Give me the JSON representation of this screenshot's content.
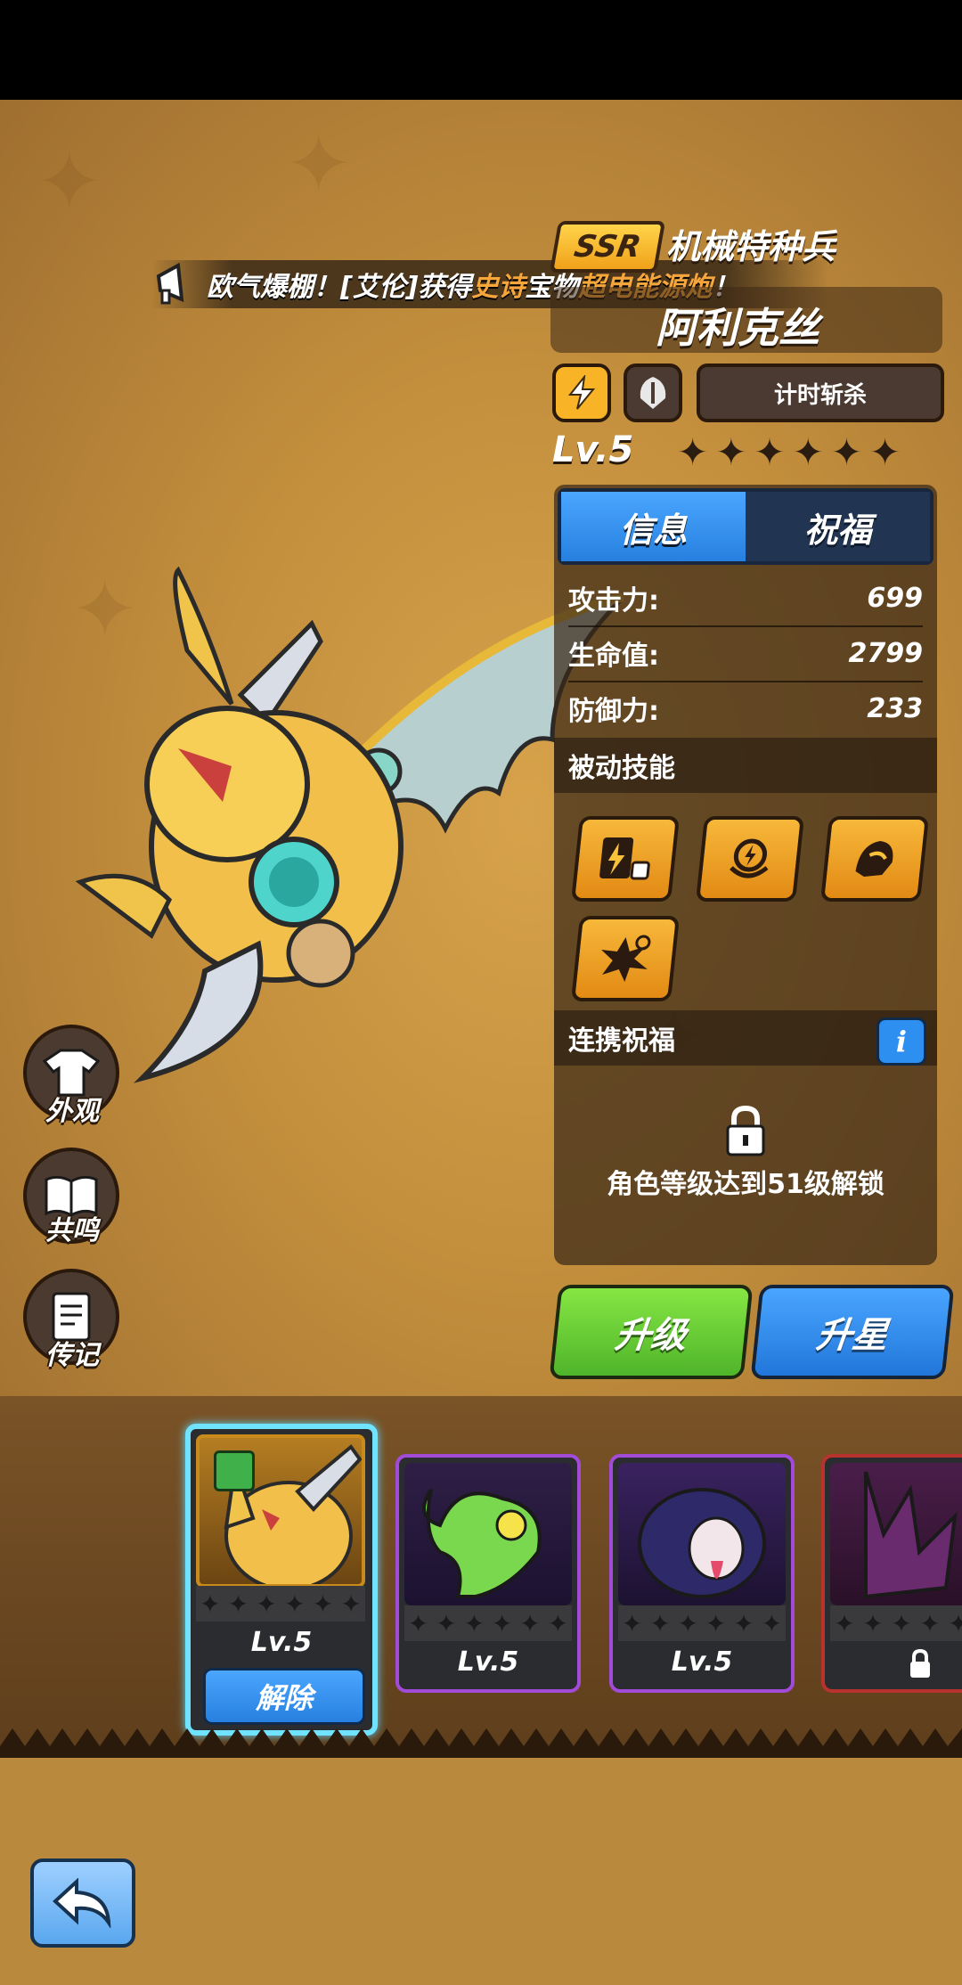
{
  "broadcast": {
    "prefix": "欧气爆棚！[艾伦]获得",
    "rarity": "史诗",
    "middle": "宝物",
    "item": "超电能源炮",
    "suffix": "！"
  },
  "hero": {
    "rarity": "SSR",
    "class_name": "机械特种兵",
    "name": "阿利克丝",
    "element_icon": "lightning-icon",
    "type_icon": "helmet-icon",
    "tag": "计时斩杀",
    "level": "Lv.5",
    "stars": [
      "✦",
      "✦",
      "✦",
      "✦",
      "✦",
      "✦"
    ]
  },
  "tabs": {
    "info": "信息",
    "blessing": "祝福"
  },
  "stats": {
    "attack_label": "攻击力:",
    "attack": "699",
    "hp_label": "生命值:",
    "hp": "2799",
    "defense_label": "防御力:",
    "defense": "233"
  },
  "passive": {
    "title": "被动技能",
    "skills": [
      "card-lightning-icon",
      "lightning-shield-icon",
      "armor-arm-icon",
      "explosion-icon"
    ]
  },
  "link": {
    "title": "连携祝福",
    "info_label": "i",
    "lock_text": "角色等级达到51级解锁"
  },
  "buttons": {
    "upgrade": "升级",
    "star_up": "升星"
  },
  "side": {
    "appearance": "外观",
    "resonance": "共鸣",
    "biography": "传记"
  },
  "roster": [
    {
      "level": "Lv.5",
      "action": "解除",
      "color": "#c88a1a",
      "selected": true
    },
    {
      "level": "Lv.5",
      "color": "#a24bd8"
    },
    {
      "level": "Lv.5",
      "color": "#a24bd8"
    },
    {
      "locked": true,
      "color": "#b8322e"
    }
  ],
  "colors": {
    "accent_blue": "#2f8df0",
    "accent_green": "#5bc22f",
    "highlight": "#f6a63a"
  }
}
